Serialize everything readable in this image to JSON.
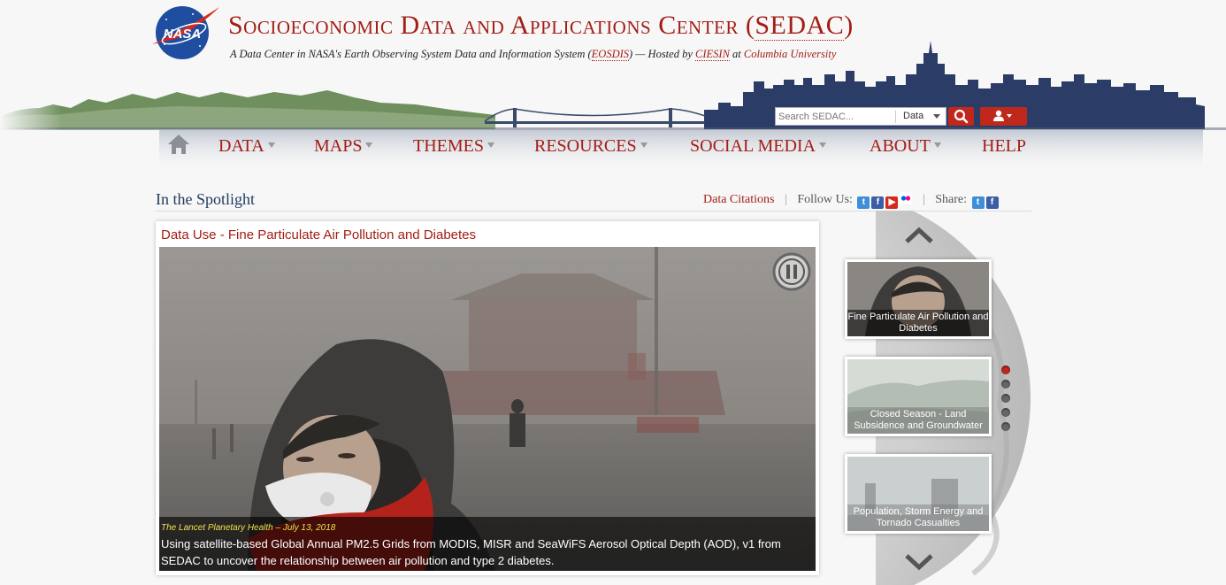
{
  "site": {
    "title_main": "Socioeconomic Data and Applications Center (",
    "title_abbr": "SEDAC",
    "title_end": ")",
    "tagline_part1": "A Data Center in NASA's Earth Observing System Data and Information System (",
    "tagline_eosdis": "EOSDIS",
    "tagline_part2": ") — Hosted by ",
    "tagline_ciesin": "CIESIN",
    "tagline_part3": " at ",
    "tagline_columbia": "Columbia University",
    "logo_text": "NASA"
  },
  "search": {
    "placeholder": "Search SEDAC...",
    "scope": "Data"
  },
  "nav": {
    "items": [
      {
        "label": "DATA"
      },
      {
        "label": "MAPS"
      },
      {
        "label": "THEMES"
      },
      {
        "label": "RESOURCES"
      },
      {
        "label": "SOCIAL MEDIA"
      },
      {
        "label": "ABOUT"
      },
      {
        "label": "HELP"
      }
    ]
  },
  "spotlight": {
    "heading": "In the Spotlight",
    "data_citations": "Data Citations",
    "follow_us": "Follow Us:",
    "share": "Share:"
  },
  "slide": {
    "title": "Data Use - Fine Particulate Air Pollution and Diabetes",
    "source": "The Lancet Planetary Health – July 13, 2018",
    "caption": "Using satellite-based Global Annual PM2.5 Grids from MODIS, MISR and SeaWiFS Aerosol Optical Depth (AOD), v1 from SEDAC to uncover the relationship between air pollution and type 2 diabetes."
  },
  "thumbnails": [
    {
      "label": "Fine Particulate Air Pollution and Diabetes"
    },
    {
      "label": "Closed Season - Land Subsidence and Groundwater"
    },
    {
      "label": "Population, Storm Energy and Tornado Casualties"
    }
  ],
  "carousel": {
    "active_index": 0,
    "count": 5
  },
  "colors": {
    "brand_red": "#a31d15",
    "button_red": "#c0281c",
    "heading_blue": "#1f3a5c"
  }
}
